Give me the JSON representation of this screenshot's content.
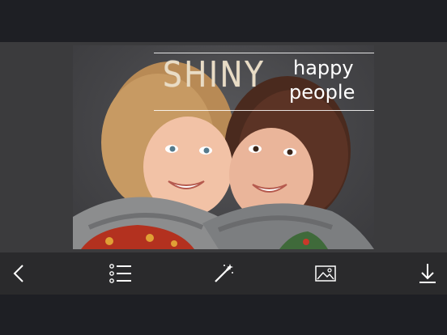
{
  "photo_text": {
    "headline": "SHINY",
    "line1": "happy",
    "line2": "people"
  },
  "toolbar": {
    "icons": [
      "back-chevron-icon",
      "list-icon",
      "magic-wand-icon",
      "image-icon",
      "download-icon"
    ]
  },
  "colors": {
    "background": "#1e1f24",
    "canvas": "#3b3b3d",
    "toolbar": "#2a2a2c",
    "icon": "#ffffff",
    "headline": "#e9dcc5"
  }
}
